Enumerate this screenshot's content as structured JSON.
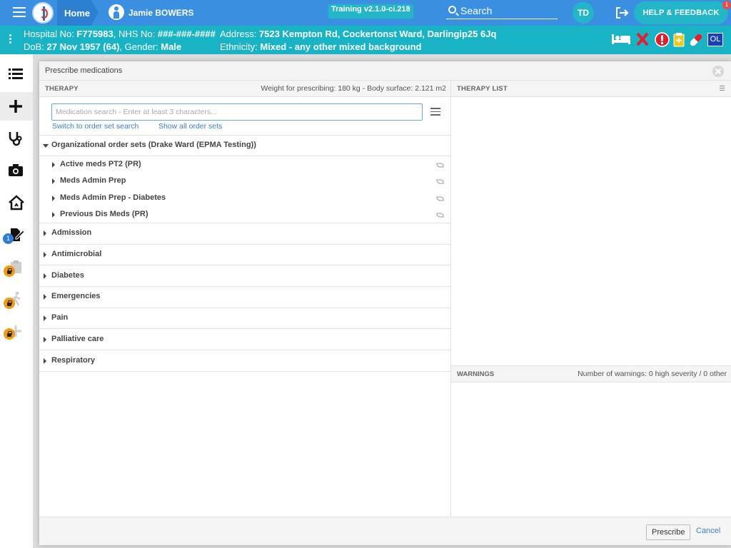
{
  "topbar": {
    "home_label": "Home",
    "patient_name": "Jamie BOWERS",
    "training_label": "Training v2.1.0-ci.218",
    "search_label": "Search",
    "avatar_initials": "TD",
    "help_label": "HELP & FEEDBACK",
    "help_badge": "1"
  },
  "banner": {
    "hospital_label": "Hospital No: ",
    "hospital_no": "F775983",
    "nhs_label": ", NHS No: ",
    "nhs_no": "###-###-####",
    "address_label": "Address: ",
    "address": "7523 Kempton Rd, Cockertonst Ward, Darlingip25 6Jq",
    "dob_label": "DoB: ",
    "dob": "27 Nov 1957 (64)",
    "gender_label": ", Gender: ",
    "gender": "Male",
    "ethnicity_label": "Ethnicity: ",
    "ethnicity": "Mixed - any other mixed background",
    "ol_label": "OL"
  },
  "leftnav": {
    "badge_count": "1"
  },
  "dialog": {
    "title": "Prescribe medications",
    "therapy": {
      "header": "THERAPY",
      "weight_info": "Weight for prescribing: 180 kg - Body surface: 2.121 m2",
      "search_placeholder": "Medication search - Enter at least 3 characters...",
      "search_value": "",
      "switch_link": "Switch to order set search",
      "show_all_link": "Show all order sets",
      "org_group": "Organizational order sets (Drake Ward (EPMA Testing))",
      "org_items": [
        "Active meds PT2 (PR)",
        "Meds Admin Prep",
        "Meds Admin Prep - Diabetes",
        "Previous Dis Meds (PR)"
      ],
      "categories": [
        "Admission",
        "Antimicrobial",
        "Diabetes",
        "Emergencies",
        "Pain",
        "Palliative care",
        "Respiratory"
      ]
    },
    "therapy_list": {
      "header": "THERAPY LIST"
    },
    "warnings": {
      "header": "WARNINGS",
      "summary": "Number of warnings: 0 high severity / 0 other"
    },
    "footer": {
      "prescribe_label": "Prescribe",
      "cancel_label": "Cancel"
    }
  },
  "colors": {
    "topbar": "#3b8fe0",
    "banner": "#19b3c6",
    "accent": "#22b6c8",
    "link": "#3a7bc8"
  }
}
